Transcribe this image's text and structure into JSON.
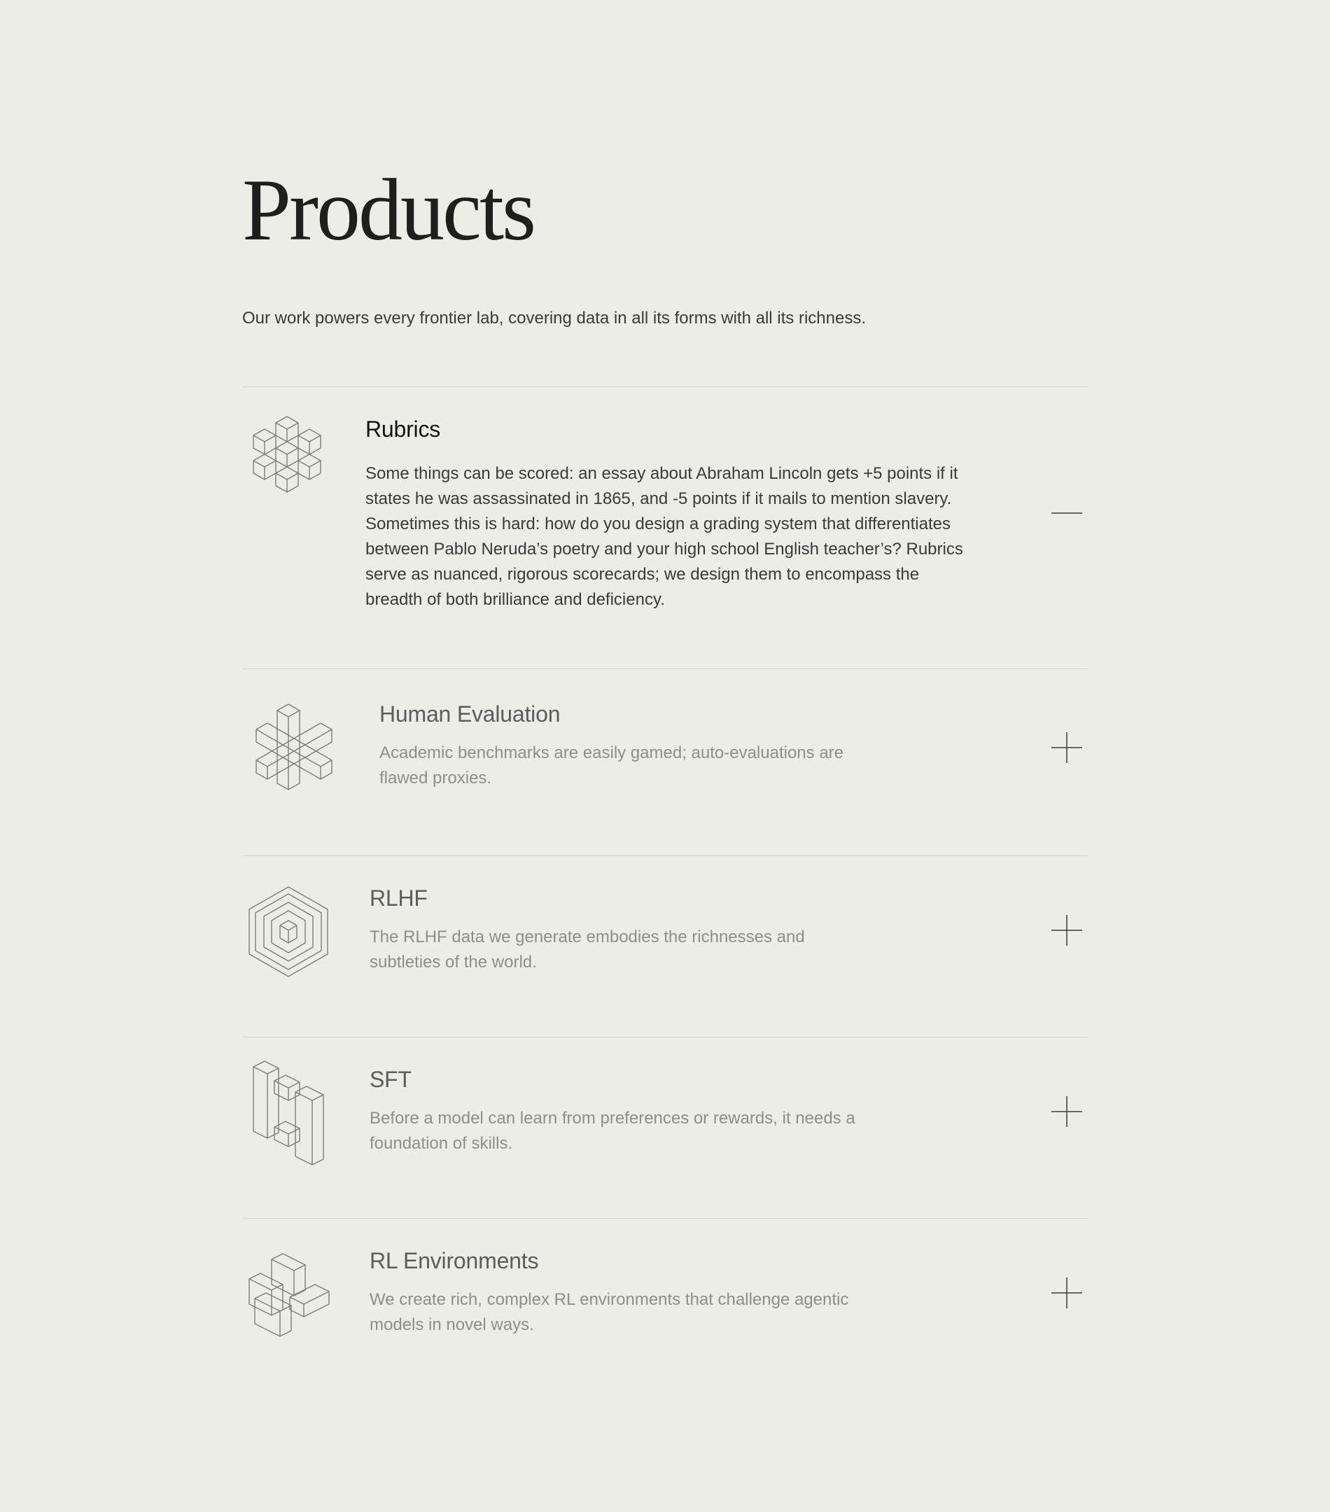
{
  "page": {
    "title": "Products",
    "subtitle": "Our work powers every frontier lab, covering data in all its forms with all its richness."
  },
  "products": [
    {
      "title": "Rubrics",
      "description": "Some things can be scored: an essay about Abraham Lincoln gets +5 points if it states he was assassinated in 1865, and -5 points if it mails to mention slavery. Sometimes this is hard: how do you design a grading system that differentiates between Pablo Neruda’s poetry and your high school English teacher’s? Rubrics serve as nuanced, rigorous scorecards; we design them to encompass the breadth of both brilliance and deficiency.",
      "icon": "cube-cluster-icon",
      "expanded": true
    },
    {
      "title": "Human Evaluation",
      "description": "Academic benchmarks are easily gamed; auto-evaluations are flawed proxies.",
      "icon": "asterisk-prism-icon",
      "expanded": false
    },
    {
      "title": "RLHF",
      "description": "The RLHF data we generate embodies the richnesses and subtleties of the world.",
      "icon": "nested-hexagon-icon",
      "expanded": false
    },
    {
      "title": "SFT",
      "description": "Before a model can learn from preferences or rewards, it needs a foundation of skills.",
      "icon": "isometric-pillars-icon",
      "expanded": false
    },
    {
      "title": "RL Environments",
      "description": "We create rich, complex RL environments that challenge agentic models in novel ways.",
      "icon": "interlocking-blocks-icon",
      "expanded": false
    }
  ],
  "toggle_icons": {
    "expanded": "minus-icon",
    "collapsed": "plus-icon"
  }
}
